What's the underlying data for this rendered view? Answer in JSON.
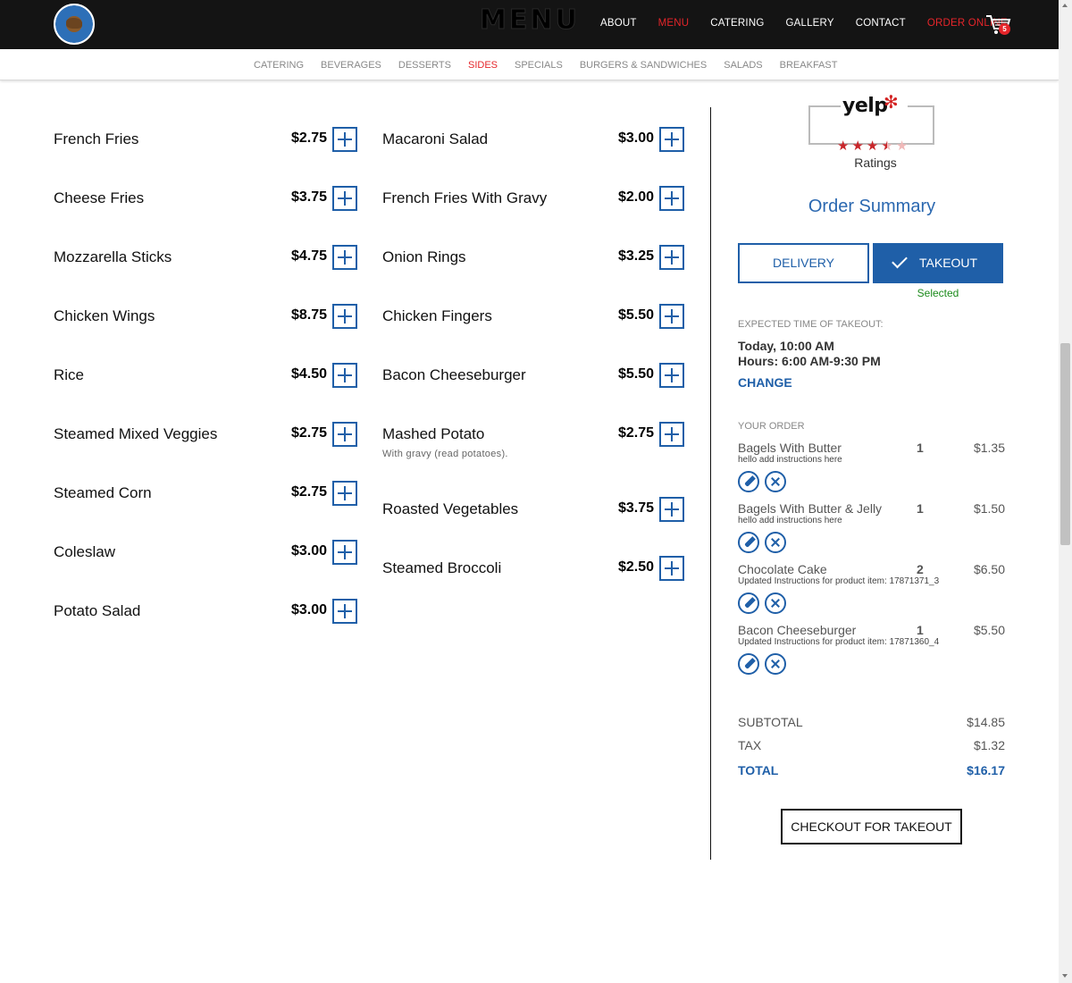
{
  "header": {
    "brand": "MENU",
    "nav": [
      "ABOUT",
      "MENU",
      "CATERING",
      "GALLERY",
      "CONTACT",
      "ORDER ONLINE"
    ],
    "cart_count": "5"
  },
  "categories": [
    "CATERING",
    "BEVERAGES",
    "DESSERTS",
    "SIDES",
    "SPECIALS",
    "BURGERS & SANDWICHES",
    "SALADS",
    "BREAKFAST"
  ],
  "menu": {
    "col1": [
      {
        "name": "French Fries",
        "price": "$2.75"
      },
      {
        "name": "Cheese Fries",
        "price": "$3.75"
      },
      {
        "name": "Mozzarella Sticks",
        "price": "$4.75"
      },
      {
        "name": "Chicken Wings",
        "price": "$8.75"
      },
      {
        "name": "Rice",
        "price": "$4.50"
      },
      {
        "name": "Steamed Mixed Veggies",
        "price": "$2.75"
      },
      {
        "name": "Steamed Corn",
        "price": "$2.75"
      },
      {
        "name": "Coleslaw",
        "price": "$3.00"
      },
      {
        "name": "Potato Salad",
        "price": "$3.00"
      }
    ],
    "col2": [
      {
        "name": "Macaroni Salad",
        "price": "$3.00"
      },
      {
        "name": "French Fries With Gravy",
        "price": "$2.00"
      },
      {
        "name": "Onion Rings",
        "price": "$3.25"
      },
      {
        "name": "Chicken Fingers",
        "price": "$5.50"
      },
      {
        "name": "Bacon Cheeseburger",
        "price": "$5.50"
      },
      {
        "name": "Mashed Potato",
        "price": "$2.75",
        "desc": "With gravy (read potatoes)."
      },
      {
        "name": "Roasted Vegetables",
        "price": "$3.75"
      },
      {
        "name": "Steamed Broccoli",
        "price": "$2.50"
      }
    ]
  },
  "sidebar": {
    "yelp_word": "yelp",
    "yelp_rating": 3.5,
    "ratings_label": "Ratings",
    "summary_title": "Order Summary",
    "delivery_label": "DELIVERY",
    "takeout_label": "TAKEOUT",
    "selected_note": "Selected",
    "expected_label": "EXPECTED TIME OF TAKEOUT:",
    "expected_time": "Today, 10:00 AM",
    "hours": "Hours: 6:00 AM-9:30 PM",
    "change_label": "CHANGE",
    "your_order_label": "YOUR ORDER",
    "order_items": [
      {
        "name": "Bagels With Butter",
        "qty": "1",
        "price": "$1.35",
        "note": "hello add instructions here"
      },
      {
        "name": "Bagels With Butter & Jelly",
        "qty": "1",
        "price": "$1.50",
        "note": "hello add instructions here"
      },
      {
        "name": "Chocolate Cake",
        "qty": "2",
        "price": "$6.50",
        "note": "Updated Instructions for product item: 17871371_3"
      },
      {
        "name": "Bacon Cheeseburger",
        "qty": "1",
        "price": "$5.50",
        "note": "Updated Instructions for product item: 17871360_4"
      }
    ],
    "subtotal_label": "SUBTOTAL",
    "subtotal": "$14.85",
    "tax_label": "TAX",
    "tax": "$1.32",
    "total_label": "TOTAL",
    "total": "$16.17",
    "checkout_label": "CHECKOUT FOR TAKEOUT"
  },
  "colors": {
    "accent_blue": "#1f5fa8",
    "accent_red": "#e5252a",
    "header_bg": "#141414"
  }
}
